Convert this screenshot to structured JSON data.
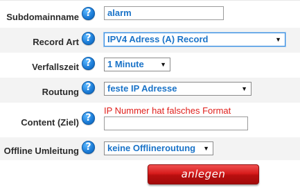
{
  "form": {
    "subdomain": {
      "label": "Subdomainname",
      "value": "alarm"
    },
    "record_type": {
      "label": "Record Art",
      "selected": "IPV4 Adress (A) Record"
    },
    "ttl": {
      "label": "Verfallszeit",
      "selected": "1 Minute"
    },
    "routing": {
      "label": "Routung",
      "selected": "feste IP Adresse"
    },
    "content": {
      "label": "Content (Ziel)",
      "error": "IP Nummer hat falsches Format",
      "value": ""
    },
    "offline": {
      "label": "Offline Umleitung",
      "selected": "keine Offlineroutung"
    },
    "help_glyph": "?",
    "submit_label": "anlegen"
  },
  "icons": {
    "help": "help-icon",
    "dropdown": "chevron-down-icon"
  },
  "colors": {
    "field_text": "#1a73c8",
    "error": "#e0201c",
    "button": "#d81c1c",
    "help": "#1f7fd9"
  }
}
